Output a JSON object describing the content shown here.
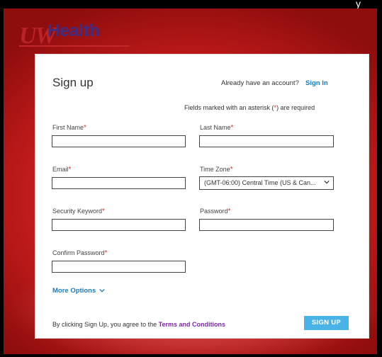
{
  "top_caption": "y",
  "logo": {
    "uw": "UW",
    "health": "Health"
  },
  "form": {
    "title": "Sign up",
    "already_text": "Already have an account?",
    "sign_in_label": "Sign In",
    "required_prefix": "Fields marked with an asterisk (",
    "required_asterisk": "*",
    "required_suffix": ") are required",
    "asterisk": "*",
    "fields": {
      "first_name": {
        "label": "First Name",
        "value": ""
      },
      "last_name": {
        "label": "Last Name",
        "value": ""
      },
      "email": {
        "label": "Email",
        "value": ""
      },
      "time_zone": {
        "label": "Time Zone",
        "value": "(GMT-06:00) Central Time (US & Can..."
      },
      "security_keyword": {
        "label": "Security Keyword",
        "value": ""
      },
      "password": {
        "label": "Password",
        "value": ""
      },
      "confirm_password": {
        "label": "Confirm Password",
        "value": ""
      }
    },
    "more_options_label": "More Options",
    "agree_text": "By clicking Sign Up, you agree to the",
    "terms_label": "Terms and Conditions",
    "signup_button": "SIGN UP"
  },
  "colors": {
    "link_blue": "#1a7bbf",
    "terms_purple": "#7a2aa0",
    "button_blue": "#49b3e8",
    "required_red": "#e03030",
    "background_red": "#d92a2a"
  }
}
